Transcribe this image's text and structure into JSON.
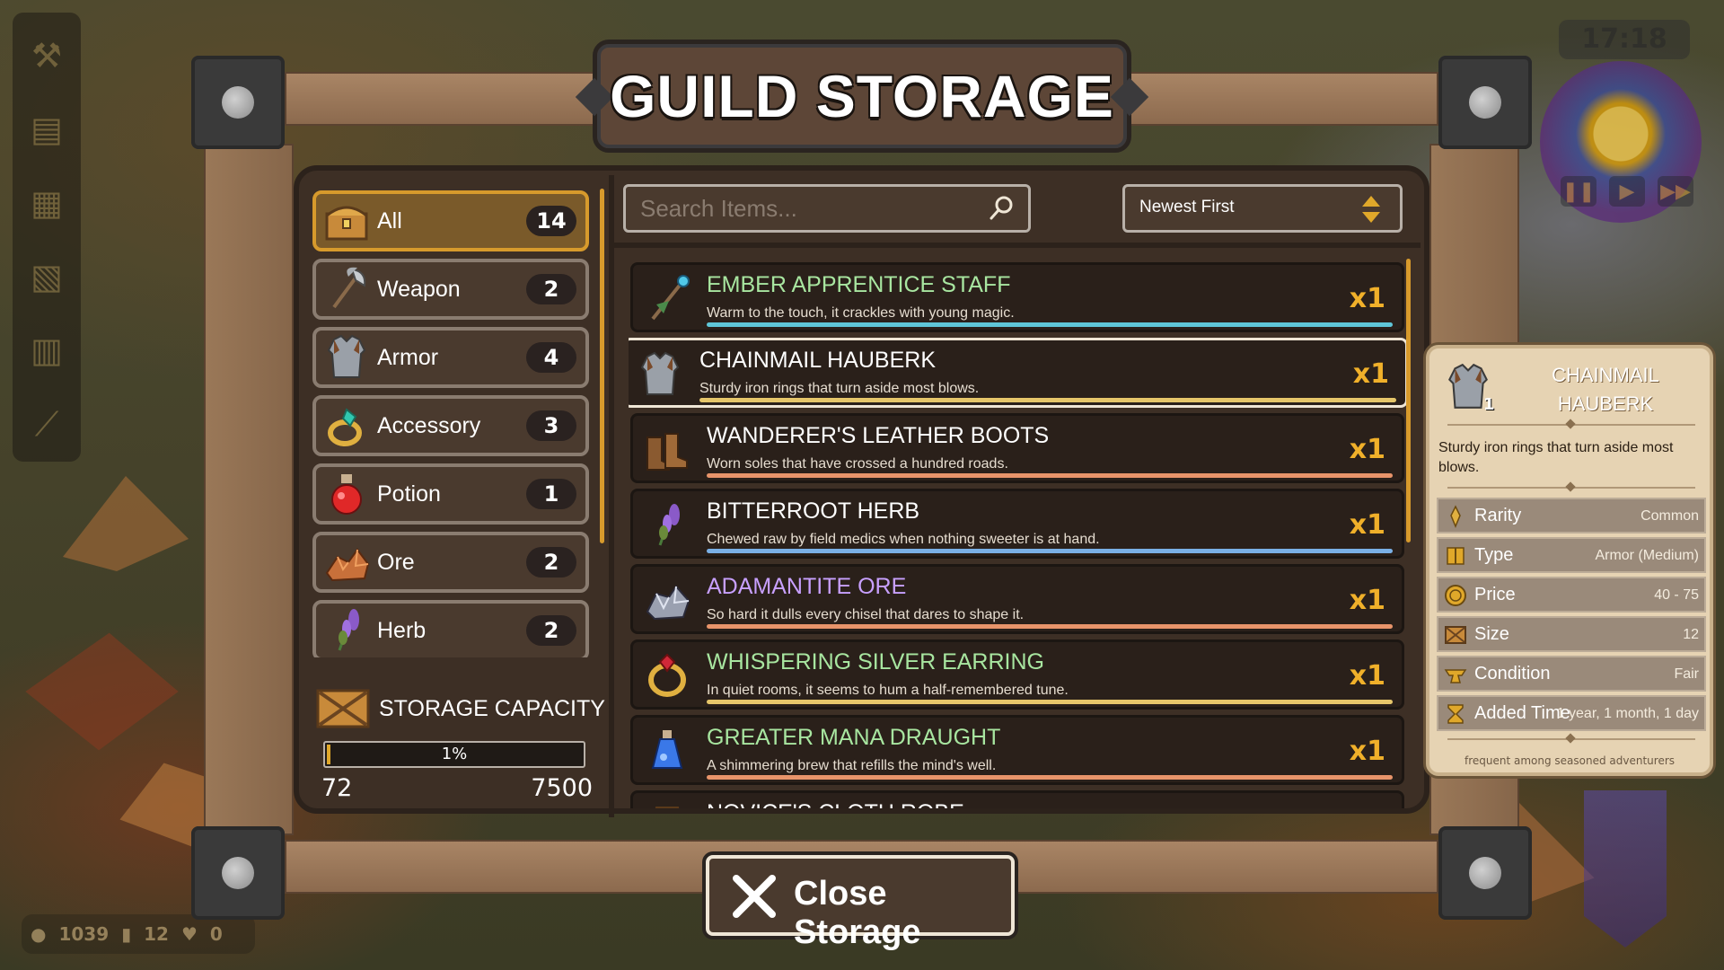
{
  "title": "GUILD STORAGE",
  "hud": {
    "clock": "17:18",
    "bottom": {
      "gold": "1039",
      "slots": "12",
      "extra": "0"
    }
  },
  "categories": [
    {
      "label": "All",
      "count": "14",
      "icon": "treasure-chest-icon",
      "active": true
    },
    {
      "label": "Weapon",
      "count": "2",
      "icon": "axe-icon",
      "active": false
    },
    {
      "label": "Armor",
      "count": "4",
      "icon": "chainmail-icon",
      "active": false
    },
    {
      "label": "Accessory",
      "count": "3",
      "icon": "ring-icon",
      "active": false
    },
    {
      "label": "Potion",
      "count": "1",
      "icon": "potion-icon",
      "active": false
    },
    {
      "label": "Ore",
      "count": "2",
      "icon": "ore-icon",
      "active": false
    },
    {
      "label": "Herb",
      "count": "2",
      "icon": "herb-icon",
      "active": false
    }
  ],
  "capacity": {
    "label": "STORAGE CAPACITY",
    "percent_label": "1%",
    "fraction": 0.0096,
    "used": "72",
    "max": "7500"
  },
  "search": {
    "placeholder": "Search Items..."
  },
  "sort": {
    "label": "Newest First"
  },
  "items": [
    {
      "name": "EMBER APPRENTICE STAFF",
      "desc": "Warm to the touch, it crackles with young magic.",
      "qty": "x1",
      "name_color": "#a8e6a0",
      "bar_color": "#5fc6d8",
      "icon": "staff-icon",
      "selected": false
    },
    {
      "name": "CHAINMAIL HAUBERK",
      "desc": "Sturdy iron rings that turn aside most blows.",
      "qty": "x1",
      "name_color": "#ffffff",
      "bar_color": "#e6c66a",
      "icon": "chainmail-icon",
      "selected": true
    },
    {
      "name": "WANDERER'S LEATHER BOOTS",
      "desc": "Worn soles that have crossed a hundred roads.",
      "qty": "x1",
      "name_color": "#ffffff",
      "bar_color": "#e8946a",
      "icon": "boots-icon",
      "selected": false
    },
    {
      "name": "BITTERROOT HERB",
      "desc": "Chewed raw by field medics when nothing sweeter is at hand.",
      "qty": "x1",
      "name_color": "#ffffff",
      "bar_color": "#7ab0e6",
      "icon": "herb-icon",
      "selected": false
    },
    {
      "name": "ADAMANTITE ORE",
      "desc": "So hard it dulls every chisel that dares to shape it.",
      "qty": "x1",
      "name_color": "#c8a0ff",
      "bar_color": "#e8946a",
      "icon": "adamantite-ore-icon",
      "selected": false
    },
    {
      "name": "WHISPERING SILVER EARRING",
      "desc": "In quiet rooms, it seems to hum a half-remembered tune.",
      "qty": "x1",
      "name_color": "#a8e6a0",
      "bar_color": "#e6c66a",
      "icon": "earring-icon",
      "selected": false
    },
    {
      "name": "GREATER MANA DRAUGHT",
      "desc": "A shimmering brew that refills the mind's well.",
      "qty": "x1",
      "name_color": "#a8e6a0",
      "bar_color": "#e8946a",
      "icon": "mana-potion-icon",
      "selected": false
    },
    {
      "name": "NOVICE'S CLOTH ROBE",
      "desc": "",
      "qty": "",
      "name_color": "#ffffff",
      "bar_color": "#e6c66a",
      "icon": "robe-icon",
      "selected": false
    }
  ],
  "detail": {
    "name": "CHAINMAIL HAUBERK",
    "level": "1",
    "desc": "Sturdy iron rings that turn aside most blows.",
    "stats": [
      {
        "label": "Rarity",
        "value": "Common",
        "icon": "rarity-icon"
      },
      {
        "label": "Type",
        "value": "Armor (Medium)",
        "icon": "type-icon"
      },
      {
        "label": "Price",
        "value": "40 - 75",
        "icon": "coin-icon"
      },
      {
        "label": "Size",
        "value": "12",
        "icon": "crate-icon"
      },
      {
        "label": "Condition",
        "value": "Fair",
        "icon": "anvil-icon"
      },
      {
        "label": "Added Time",
        "value": "1 year, 1 month, 1 day",
        "icon": "hourglass-icon"
      }
    ],
    "footer": "frequent among seasoned adventurers"
  },
  "close_button": {
    "label": "Close Storage"
  }
}
